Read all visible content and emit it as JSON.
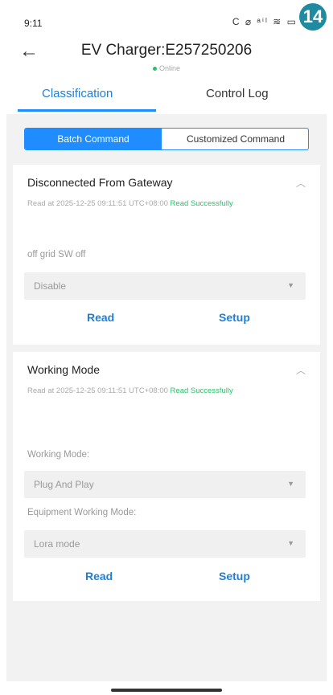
{
  "status_bar": {
    "time": "9:11",
    "icons": "C ⌀ ᵃⁱˡ ≋ ▭",
    "badge": "14"
  },
  "header": {
    "title": "EV Charger:E257250206",
    "status": "Online"
  },
  "tabs": [
    {
      "label": "Classification",
      "active": true
    },
    {
      "label": "Control Log",
      "active": false
    }
  ],
  "segments": [
    {
      "label": "Batch Command",
      "active": true
    },
    {
      "label": "Customized Command",
      "active": false
    }
  ],
  "cards": [
    {
      "title": "Disconnected From Gateway",
      "read_info": "Read at 2025-12-25 09:11:51 UTC+08:00",
      "read_status": "Read Successfully",
      "fields": [
        {
          "label": "off grid SW off",
          "value": "Disable"
        }
      ],
      "read_label": "Read",
      "setup_label": "Setup"
    },
    {
      "title": "Working Mode",
      "read_info": "Read at 2025-12-25 09:11:51 UTC+08:00",
      "read_status": "Read Successfully",
      "fields": [
        {
          "label": "Working Mode:",
          "value": "Plug And Play"
        },
        {
          "label": "Equipment Working Mode:",
          "value": "Lora mode"
        }
      ],
      "read_label": "Read",
      "setup_label": "Setup"
    }
  ],
  "colors": {
    "accent": "#1f8cff",
    "success": "#2cbf6a",
    "badge": "#1e8ba0"
  }
}
